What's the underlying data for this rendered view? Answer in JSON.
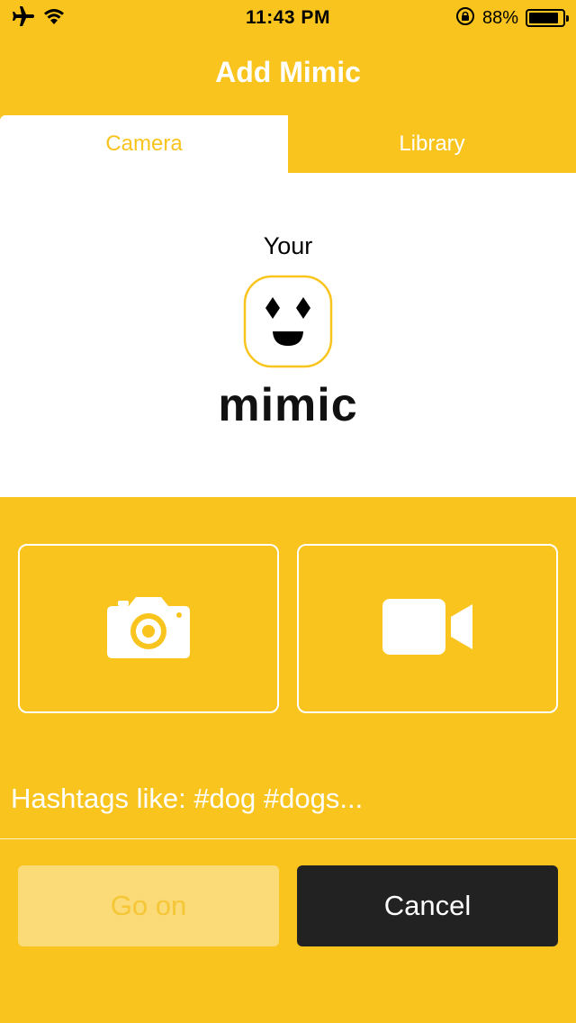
{
  "status_bar": {
    "time": "11:43 PM",
    "battery_percent": "88%",
    "battery_level": 0.88,
    "icons": [
      "airplane-icon",
      "wifi-icon",
      "orientation-lock-icon",
      "battery-icon"
    ]
  },
  "nav": {
    "title": "Add Mimic"
  },
  "tabs": [
    {
      "label": "Camera",
      "active": true
    },
    {
      "label": "Library",
      "active": false
    }
  ],
  "preview": {
    "prefix": "Your",
    "logo_text": "mimic",
    "logo_icon": "mimic-face-icon"
  },
  "capture": {
    "photo_icon": "camera-icon",
    "video_icon": "video-camera-icon"
  },
  "hashtags": {
    "placeholder": "Hashtags like: #dog #dogs...",
    "value": ""
  },
  "actions": {
    "go_on_label": "Go on",
    "cancel_label": "Cancel"
  },
  "colors": {
    "accent": "#F9C41E",
    "white": "#FFFFFF",
    "dark": "#222222",
    "disabled_bg": "#FADB78"
  }
}
